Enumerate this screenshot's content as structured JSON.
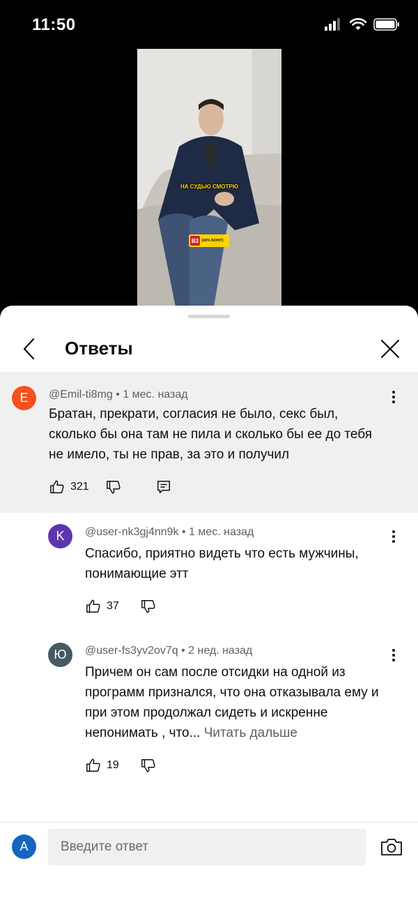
{
  "status_bar": {
    "time": "11:50"
  },
  "video": {
    "caption": "НА СУДЬЮ СМОТРЮ",
    "badge_logo": "B3",
    "badge_text": "100% БОНУС"
  },
  "sheet": {
    "title": "Ответы",
    "back_icon": "chevron-left-icon",
    "close_icon": "close-icon"
  },
  "parent_comment": {
    "avatar_letter": "E",
    "avatar_color": "#f4511e",
    "author": "@Emil-ti8mg",
    "time": "1 мес. назад",
    "text": "Братан, прекрати, согласия не было, секс был, сколько бы она там не пила и сколько бы ее до тебя не имело, ты не прав, за это и получил",
    "likes": "321"
  },
  "replies": [
    {
      "avatar_letter": "K",
      "avatar_color": "#5e35b1",
      "author": "@user-nk3gj4nn9k",
      "time": "1 мес. назад",
      "text": "Спасибо, приятно видеть что есть мужчины, понимающие этт",
      "likes": "37"
    },
    {
      "avatar_letter": "Ю",
      "avatar_color": "#455a64",
      "author": "@user-fs3yv2ov7q",
      "time": "2 нед. назад",
      "text": "Причем он сам после отсидки на одной из программ признался, что она отказывала ему и при этом продолжал сидеть и искренне непонимать , что...",
      "read_more": "Читать дальше",
      "likes": "19"
    }
  ],
  "reply_bar": {
    "avatar_letter": "A",
    "avatar_color": "#1565c0",
    "placeholder": "Введите ответ"
  }
}
